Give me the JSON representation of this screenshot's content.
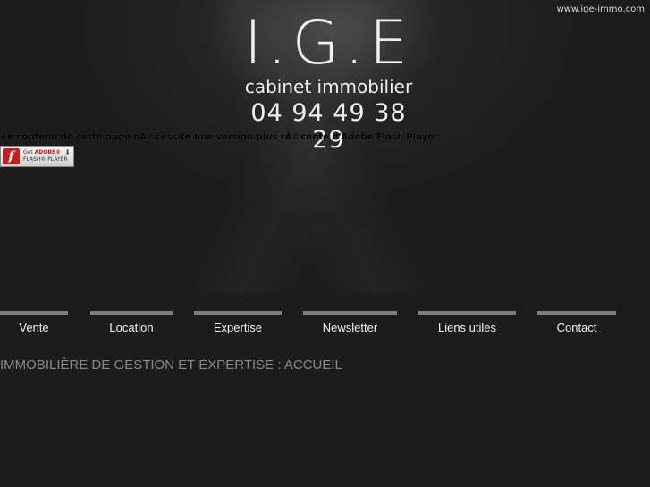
{
  "header": {
    "site_url": "www.ige-immo.com",
    "logo_title": "I.G.E",
    "logo_subtitle": "cabinet immobilier",
    "phone": "04 94 49 38 29"
  },
  "flash": {
    "message": "Le contenu de cette page nÃ©cessite une version plus rÃ©cente d'Adobe Flash Player.",
    "badge_get": "Get",
    "badge_adobe": "ADOBE®",
    "badge_player": "FLASH® PLAYER",
    "logo_glyph": "f"
  },
  "nav": {
    "items": [
      {
        "label": "Vente"
      },
      {
        "label": "Location"
      },
      {
        "label": "Expertise"
      },
      {
        "label": "Newsletter"
      },
      {
        "label": "Liens utiles"
      },
      {
        "label": "Contact"
      }
    ]
  },
  "page": {
    "heading": "IMMOBILIÈRE DE GESTION ET EXPERTISE : ACCUEIL"
  },
  "colors": {
    "background": "#1c1c1c",
    "nav_bar": "#7d7d7d",
    "heading": "#8a8a8a",
    "flash_red": "#c41e1e"
  },
  "icons": {
    "flash_logo": "flash-player-icon",
    "download_arrow": "download-arrow-icon"
  }
}
